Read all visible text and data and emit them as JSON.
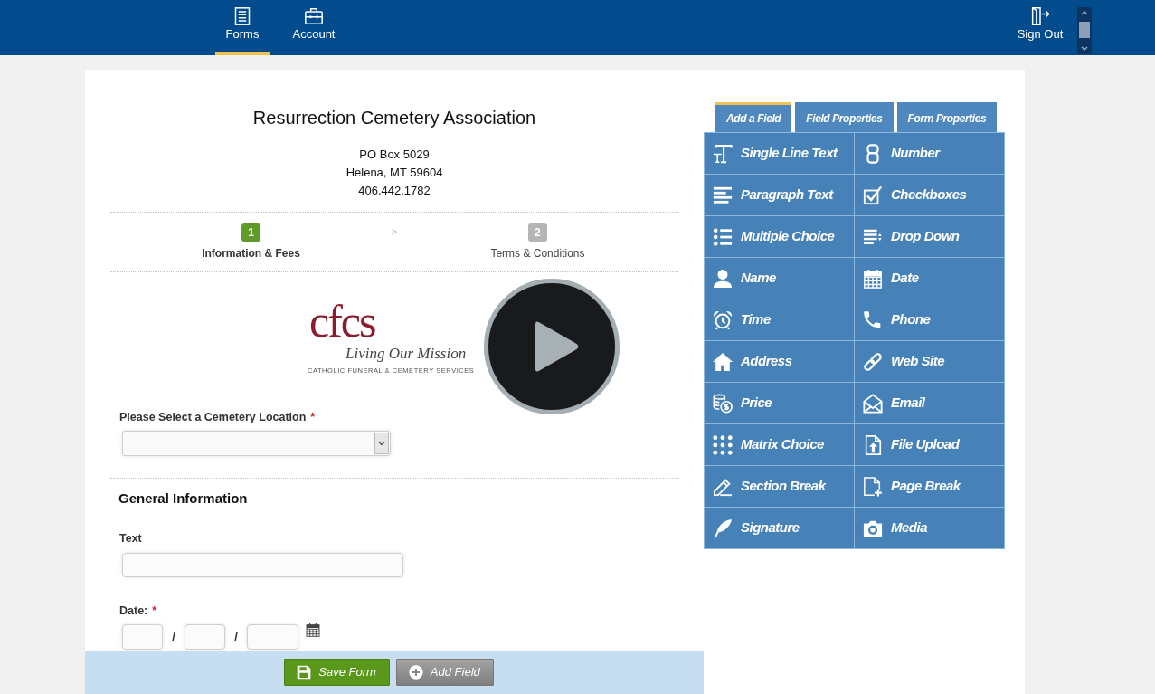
{
  "top_nav": {
    "items": [
      {
        "kind": "forms",
        "label": "Forms",
        "selected": true
      },
      {
        "kind": "account",
        "label": "Account",
        "selected": false
      }
    ],
    "sign_out": {
      "label": "Sign Out"
    }
  },
  "form": {
    "title": "Resurrection Cemetery Association",
    "address_lines": [
      "PO Box 5029",
      "Helena, MT 59604",
      "406.442.1782"
    ],
    "steps": [
      {
        "number": "1",
        "label": "Information & Fees",
        "selected": true
      },
      {
        "number": "2",
        "label": "Terms & Conditions",
        "selected": false
      }
    ],
    "step_separator": ">",
    "logo": {
      "monogram": "cfcs",
      "tagline": "Living Our Mission",
      "subtitle": "CATHOLIC FUNERAL & CEMETERY SERVICES"
    },
    "fields": [
      {
        "kind": "select",
        "label": "Please Select a Cemetery Location",
        "required_mark": "*"
      },
      {
        "kind": "section",
        "label": "General Information"
      },
      {
        "kind": "text",
        "label": "Text"
      },
      {
        "kind": "date",
        "label": "Date:",
        "required_mark": "*",
        "separators": [
          "/",
          "/"
        ]
      }
    ]
  },
  "field_panel": {
    "tabs": [
      {
        "label": "Add a Field",
        "selected": true
      },
      {
        "label": "Field Properties",
        "selected": false
      },
      {
        "label": "Form Properties",
        "selected": false
      }
    ],
    "field_types": [
      {
        "kind": "text",
        "label": "Single Line Text"
      },
      {
        "kind": "number",
        "label": "Number"
      },
      {
        "kind": "paragraph",
        "label": "Paragraph Text"
      },
      {
        "kind": "checkbox",
        "label": "Checkboxes"
      },
      {
        "kind": "choice",
        "label": "Multiple Choice"
      },
      {
        "kind": "dropdown",
        "label": "Drop Down"
      },
      {
        "kind": "name",
        "label": "Name"
      },
      {
        "kind": "date",
        "label": "Date"
      },
      {
        "kind": "time",
        "label": "Time"
      },
      {
        "kind": "phone",
        "label": "Phone"
      },
      {
        "kind": "address",
        "label": "Address"
      },
      {
        "kind": "website",
        "label": "Web Site"
      },
      {
        "kind": "price",
        "label": "Price"
      },
      {
        "kind": "email",
        "label": "Email"
      },
      {
        "kind": "matrix",
        "label": "Matrix Choice"
      },
      {
        "kind": "upload",
        "label": "File Upload"
      },
      {
        "kind": "section",
        "label": "Section Break"
      },
      {
        "kind": "pagebreak",
        "label": "Page Break"
      },
      {
        "kind": "signature",
        "label": "Signature"
      },
      {
        "kind": "media",
        "label": "Media"
      }
    ]
  },
  "action_bar": {
    "buttons": [
      {
        "kind": "save",
        "label": "Save Form"
      },
      {
        "kind": "add",
        "label": "Add Field"
      }
    ]
  }
}
